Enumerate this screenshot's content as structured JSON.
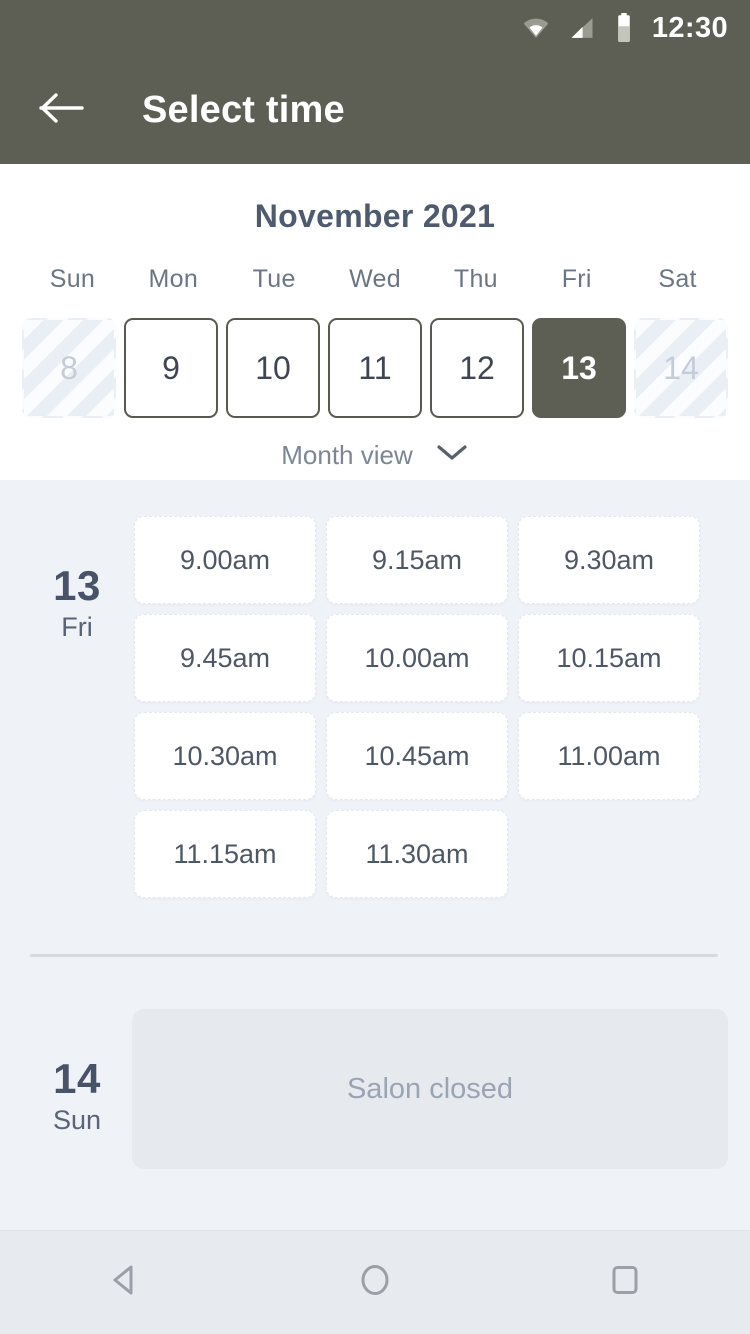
{
  "statusbar": {
    "time": "12:30",
    "icons": [
      "wifi-icon",
      "cellular-signal-icon",
      "battery-icon"
    ]
  },
  "appbar": {
    "back_icon": "arrow-left-icon",
    "title": "Select time"
  },
  "calendar": {
    "month_title": "November 2021",
    "day_headers": [
      "Sun",
      "Mon",
      "Tue",
      "Wed",
      "Thu",
      "Fri",
      "Sat"
    ],
    "dates": [
      {
        "num": "8",
        "state": "disabled"
      },
      {
        "num": "9",
        "state": "enabled"
      },
      {
        "num": "10",
        "state": "enabled"
      },
      {
        "num": "11",
        "state": "enabled"
      },
      {
        "num": "12",
        "state": "enabled"
      },
      {
        "num": "13",
        "state": "selected"
      },
      {
        "num": "14",
        "state": "disabled"
      }
    ],
    "view_toggle": {
      "label": "Month view",
      "icon": "chevron-down-icon"
    }
  },
  "schedule": {
    "days": [
      {
        "day_num": "13",
        "day_dow": "Fri",
        "slots": [
          "9.00am",
          "9.15am",
          "9.30am",
          "9.45am",
          "10.00am",
          "10.15am",
          "10.30am",
          "10.45am",
          "11.00am",
          "11.15am",
          "11.30am"
        ],
        "closed_message": null
      },
      {
        "day_num": "14",
        "day_dow": "Sun",
        "slots": [],
        "closed_message": "Salon closed"
      }
    ]
  },
  "navbar": {
    "back": "nav-back-icon",
    "home": "nav-home-icon",
    "recents": "nav-recents-icon"
  },
  "colors": {
    "accent": "#5d5f55",
    "page_bg": "#eff2f7",
    "panel_bg": "#ffffff",
    "text_primary": "#4e5a6e",
    "text_muted": "#9aa4b4",
    "navbar_bg": "#e7eaee"
  }
}
